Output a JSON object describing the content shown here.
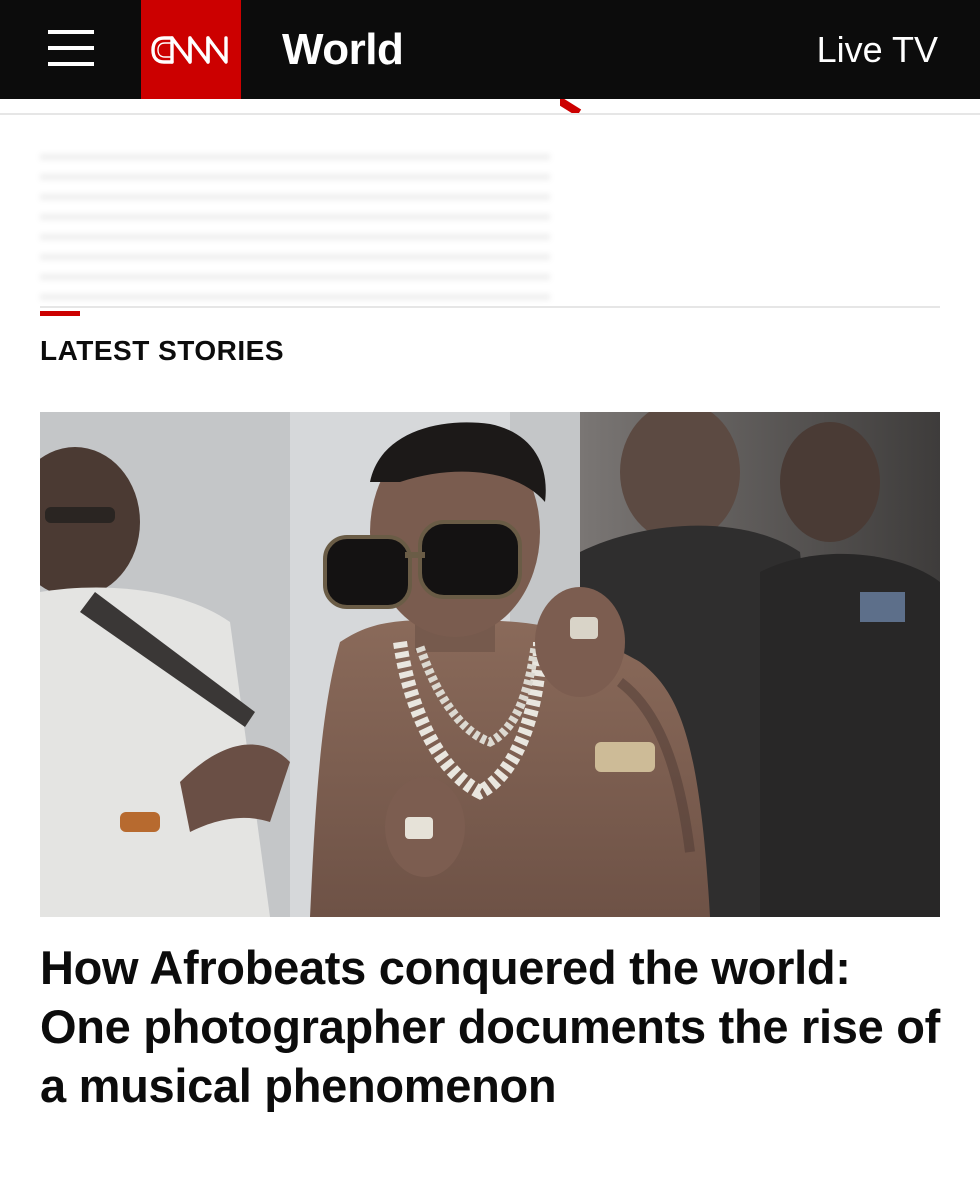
{
  "header": {
    "brand": "CNN",
    "section_title": "World",
    "live_tv_label": "Live TV",
    "colors": {
      "bar": "#0c0c0c",
      "brand_red": "#cc0000",
      "text": "#ffffff"
    }
  },
  "icons": {
    "menu": "hamburger-menu-icon",
    "logo": "cnn-logo"
  },
  "latest": {
    "label": "LATEST STORIES",
    "story": {
      "headline": "How Afrobeats conquered the world: One photographer documents the rise of a musical phenomenon"
    }
  }
}
